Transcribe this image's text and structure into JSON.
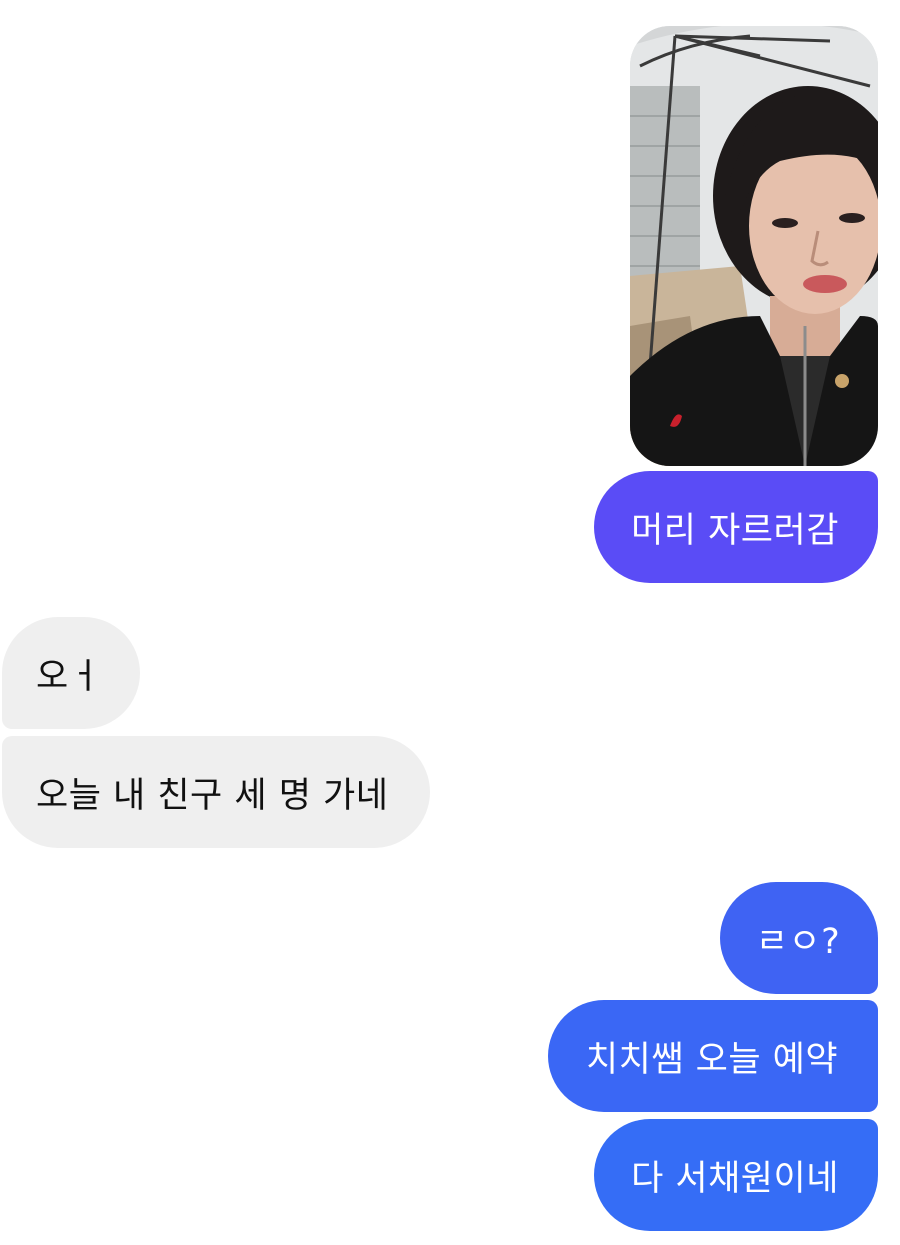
{
  "chat": {
    "photo": {
      "alt": "selfie-photo",
      "icon": "image-thumbnail"
    },
    "messages": [
      {
        "id": "b1",
        "side": "outgoing",
        "text": "머리 자르러감"
      },
      {
        "id": "b2",
        "side": "incoming",
        "text": "오ㅓ"
      },
      {
        "id": "b3",
        "side": "incoming",
        "text": "오늘 내 친구 세 명 가네"
      },
      {
        "id": "b4",
        "side": "outgoing",
        "text": "ㄹㅇ?"
      },
      {
        "id": "b5",
        "side": "outgoing",
        "text": "치치쌤 오늘 예약"
      },
      {
        "id": "b6",
        "side": "outgoing",
        "text": "다 서채원이네"
      }
    ]
  },
  "colors": {
    "outgoing_top": "#5a4cf6",
    "outgoing_bottom": "#356df6",
    "incoming": "#efefef",
    "background": "#ffffff"
  }
}
